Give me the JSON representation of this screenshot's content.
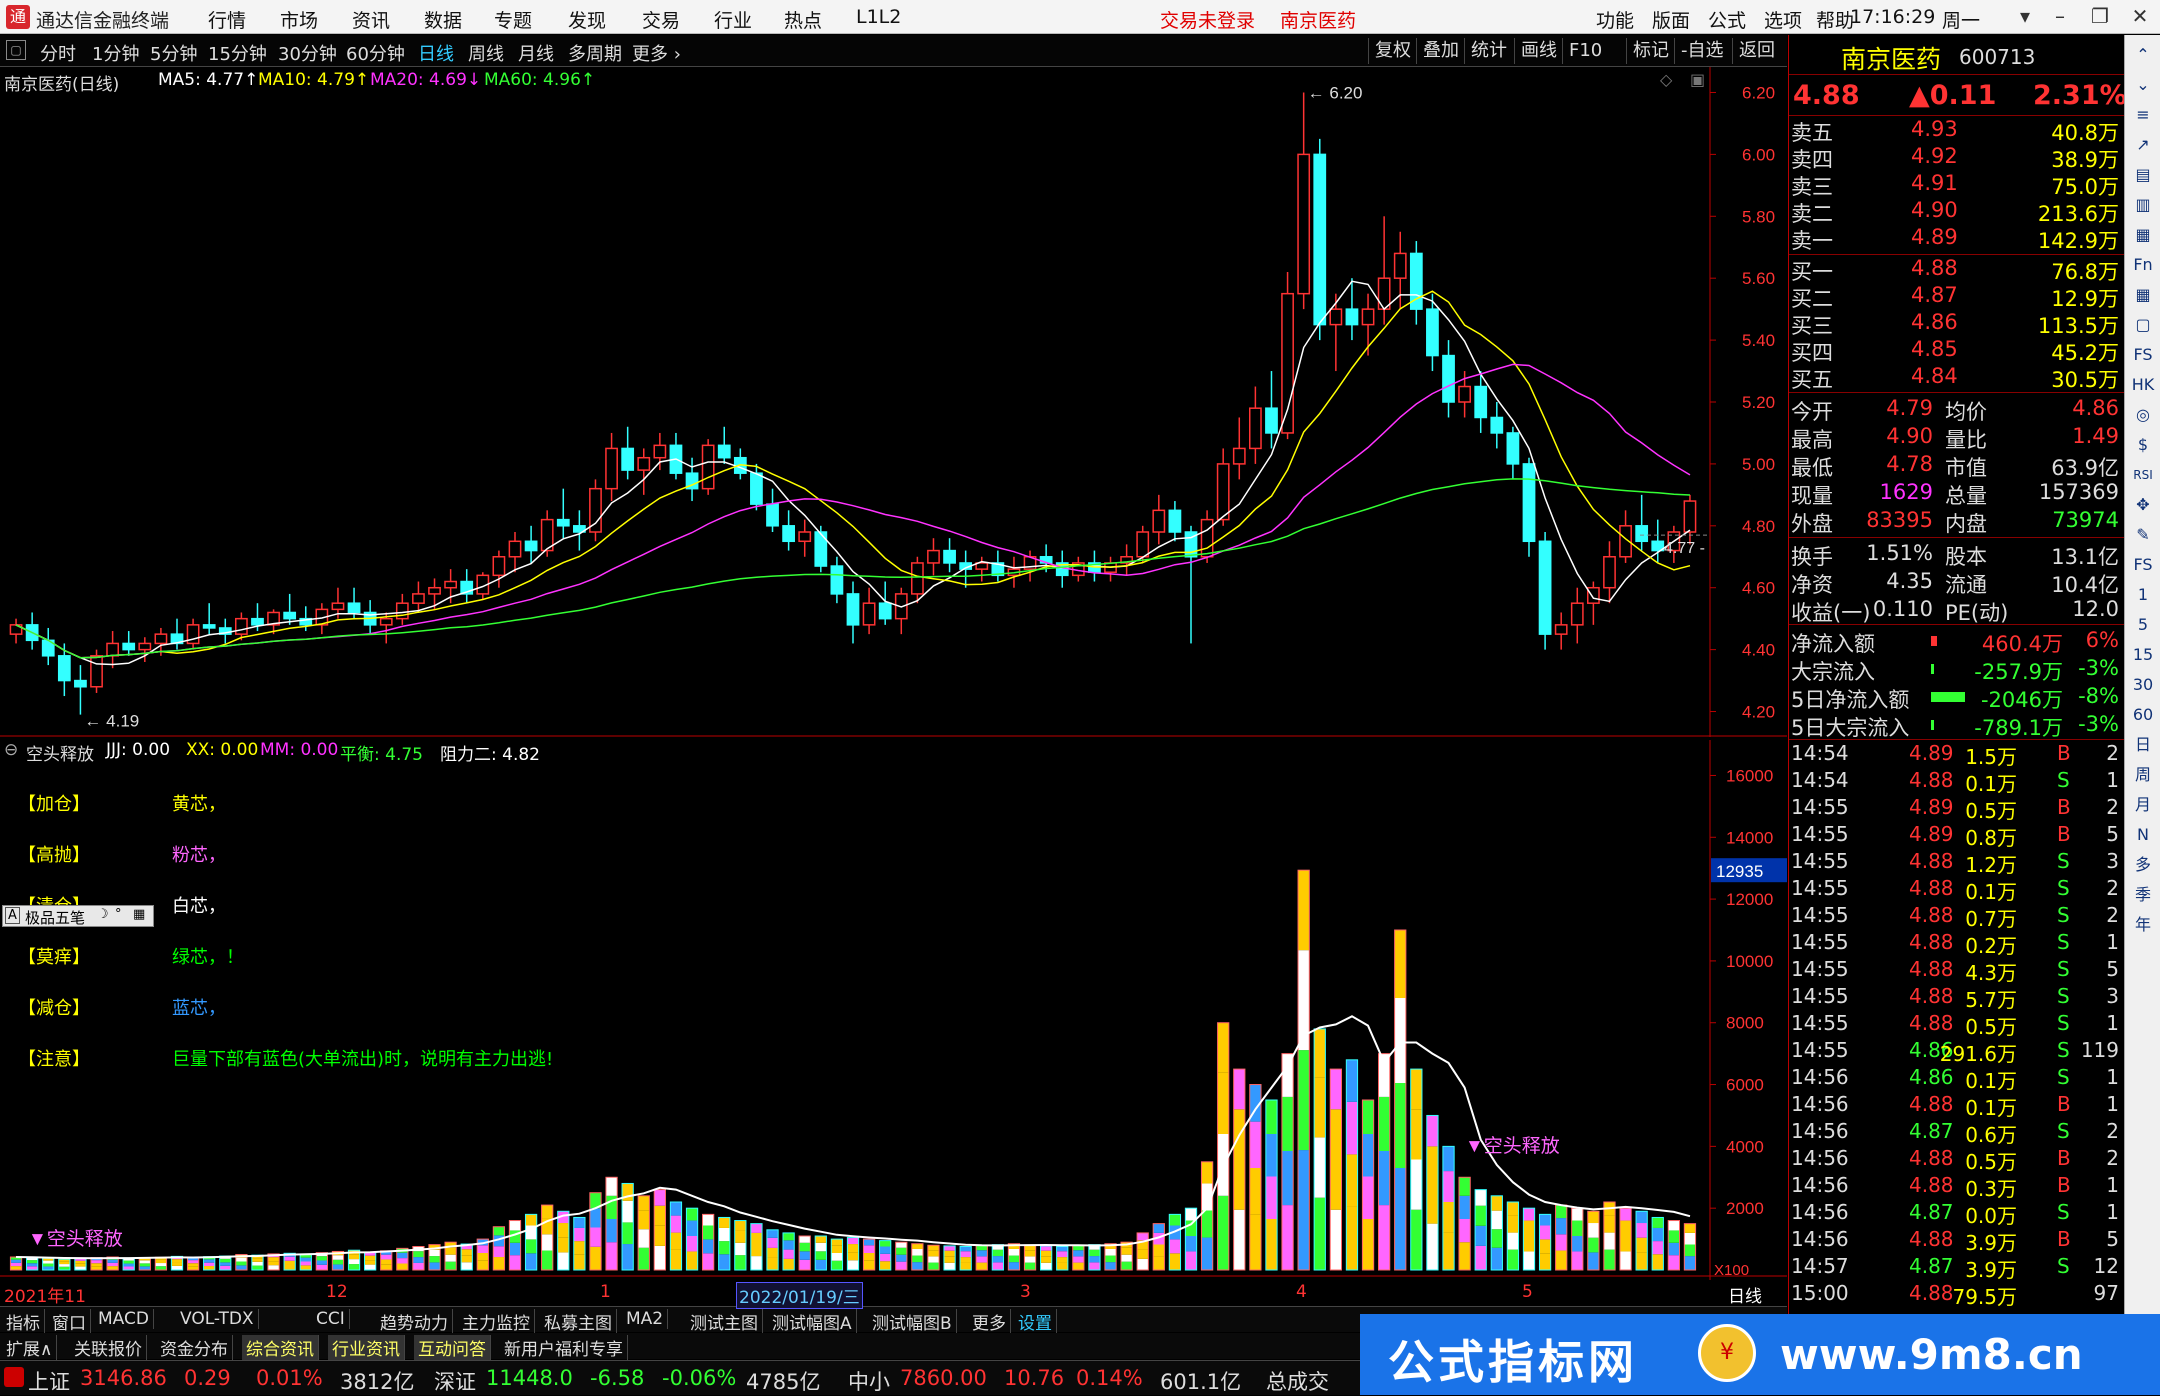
{
  "app": {
    "title": "通达信金融终端",
    "menu": [
      "行情",
      "市场",
      "资讯",
      "数据",
      "专题",
      "发现",
      "交易",
      "行业",
      "热点",
      "L1L2"
    ],
    "menu_red": [
      "交易未登录",
      "南京医药"
    ],
    "right_menu": [
      "功能",
      "版面",
      "公式",
      "选项",
      "帮助"
    ],
    "time": "17:16:29",
    "weekday": "周一"
  },
  "periods": [
    "分时",
    "1分钟",
    "5分钟",
    "15分钟",
    "30分钟",
    "60分钟",
    "日线",
    "周线",
    "月线",
    "多周期",
    "更多"
  ],
  "active_period": "日线",
  "chart_buttons": [
    "复权",
    "叠加",
    "统计",
    "画线",
    "F10",
    "标记",
    "-自选",
    "返回"
  ],
  "ma_bar": {
    "name": "南京医药(日线)",
    "ma5": "MA5: 4.77↑",
    "ma10": "MA10: 4.79↑",
    "ma20": "MA20: 4.69↓",
    "ma60": "MA60: 4.96↑"
  },
  "price_axis": [
    "6.20",
    "6.00",
    "5.80",
    "5.60",
    "5.40",
    "5.20",
    "5.00",
    "4.80",
    "4.60",
    "4.40",
    "4.20"
  ],
  "price_markers": {
    "high": "6.20",
    "low": "4.19",
    "last": "4.77"
  },
  "vol_axis": [
    "16000",
    "14000",
    "12000",
    "10000",
    "8000",
    "6000",
    "4000",
    "2000"
  ],
  "vol_current": "12935",
  "vol_unit": "X100",
  "date_axis": [
    "2021年11",
    "12",
    "1",
    "2022/01/19/三",
    "3",
    "4",
    "5"
  ],
  "indicator_bar": {
    "name": "空头释放",
    "jjj": "JJJ: 0.00",
    "xx": "XX: 0.00",
    "mm": "MM: 0.00",
    "pingheng": "平衡: 4.75",
    "zuli2": "阻力二: 4.82"
  },
  "legend": [
    {
      "tag": "【加仓】",
      "text": "黄芯，",
      "color": "#ffff00"
    },
    {
      "tag": "【高抛】",
      "text": "粉芯，",
      "color": "#ff66ff"
    },
    {
      "tag": "【清仓】",
      "text": "白芯，",
      "color": "#ffffff"
    },
    {
      "tag": "【莫痒】",
      "text": "绿芯，！",
      "color": "#00ff00"
    },
    {
      "tag": "【减仓】",
      "text": "蓝芯，",
      "color": "#3399ff"
    },
    {
      "tag": "【注意】",
      "text": "巨量下部有蓝色(大单流出)时，说明有主力出逃!",
      "color": "#00ff00"
    }
  ],
  "popup": {
    "label": "极品五笔"
  },
  "signals": [
    "▼空头释放",
    "▼空头释放"
  ],
  "quote": {
    "name": "南京医药",
    "code": "600713",
    "price": "4.88",
    "change": "▲0.11",
    "pct": "2.31%"
  },
  "order_book": {
    "sell": [
      {
        "label": "卖五",
        "price": "4.93",
        "vol": "40.8万"
      },
      {
        "label": "卖四",
        "price": "4.92",
        "vol": "38.9万"
      },
      {
        "label": "卖三",
        "price": "4.91",
        "vol": "75.0万"
      },
      {
        "label": "卖二",
        "price": "4.90",
        "vol": "213.6万"
      },
      {
        "label": "卖一",
        "price": "4.89",
        "vol": "142.9万"
      }
    ],
    "buy": [
      {
        "label": "买一",
        "price": "4.88",
        "vol": "76.8万"
      },
      {
        "label": "买二",
        "price": "4.87",
        "vol": "12.9万"
      },
      {
        "label": "买三",
        "price": "4.86",
        "vol": "113.5万"
      },
      {
        "label": "买四",
        "price": "4.85",
        "vol": "45.2万"
      },
      {
        "label": "买五",
        "price": "4.84",
        "vol": "30.5万"
      }
    ]
  },
  "stats": [
    {
      "l1": "今开",
      "v1": "4.79",
      "l2": "均价",
      "v2": "4.86"
    },
    {
      "l1": "最高",
      "v1": "4.90",
      "l2": "量比",
      "v2": "1.49"
    },
    {
      "l1": "最低",
      "v1": "4.78",
      "l2": "市值",
      "v2": "63.9亿"
    },
    {
      "l1": "现量",
      "v1": "1629",
      "l2": "总量",
      "v2": "157369"
    },
    {
      "l1": "外盘",
      "v1": "83395",
      "l2": "内盘",
      "v2": "73974"
    }
  ],
  "stats2": [
    {
      "l1": "换手",
      "v1": "1.51%",
      "l2": "股本",
      "v2": "13.1亿"
    },
    {
      "l1": "净资",
      "v1": "4.35",
      "l2": "流通",
      "v2": "10.4亿"
    },
    {
      "l1": "收益(一)",
      "v1": "0.110",
      "l2": "PE(动)",
      "v2": "12.0"
    }
  ],
  "flows": [
    {
      "label": "净流入额",
      "val": "460.4万",
      "pct": "6%"
    },
    {
      "label": "大宗流入",
      "val": "-257.9万",
      "pct": "-3%"
    },
    {
      "label": "5日净流入额",
      "val": "-2046万",
      "pct": "-8%"
    },
    {
      "label": "5日大宗流入",
      "val": "-789.1万",
      "pct": "-3%"
    }
  ],
  "ticks": [
    [
      "14:54",
      "4.89",
      "1.5万",
      "B",
      "2"
    ],
    [
      "14:54",
      "4.88",
      "0.1万",
      "S",
      "1"
    ],
    [
      "14:55",
      "4.89",
      "0.5万",
      "B",
      "2"
    ],
    [
      "14:55",
      "4.89",
      "0.8万",
      "B",
      "5"
    ],
    [
      "14:55",
      "4.88",
      "1.2万",
      "S",
      "3"
    ],
    [
      "14:55",
      "4.88",
      "0.1万",
      "S",
      "2"
    ],
    [
      "14:55",
      "4.88",
      "0.7万",
      "S",
      "2"
    ],
    [
      "14:55",
      "4.88",
      "0.2万",
      "S",
      "1"
    ],
    [
      "14:55",
      "4.88",
      "4.3万",
      "S",
      "5"
    ],
    [
      "14:55",
      "4.88",
      "5.7万",
      "S",
      "3"
    ],
    [
      "14:55",
      "4.88",
      "0.5万",
      "S",
      "1"
    ],
    [
      "14:55",
      "4.86",
      "291.6万",
      "S",
      "119"
    ],
    [
      "14:56",
      "4.86",
      "0.1万",
      "S",
      "1"
    ],
    [
      "14:56",
      "4.88",
      "0.1万",
      "B",
      "1"
    ],
    [
      "14:56",
      "4.87",
      "0.6万",
      "S",
      "2"
    ],
    [
      "14:56",
      "4.88",
      "0.5万",
      "B",
      "2"
    ],
    [
      "14:56",
      "4.88",
      "0.3万",
      "B",
      "1"
    ],
    [
      "14:56",
      "4.87",
      "0.0万",
      "S",
      "1"
    ],
    [
      "14:56",
      "4.88",
      "3.9万",
      "B",
      "5"
    ],
    [
      "14:57",
      "4.87",
      "3.9万",
      "S",
      "12"
    ],
    [
      "15:00",
      "4.88",
      "79.5万",
      "",
      "97"
    ]
  ],
  "tabs1": [
    "指标",
    "窗口",
    "MACD",
    "VOL-TDX",
    "CCI",
    "趋势动力",
    "主力监控",
    "私募主图",
    "MA2",
    "测试主图",
    "测试幅图A",
    "测试幅图B",
    "更多",
    "设置"
  ],
  "tabs2": [
    "扩展∧",
    "关联报价",
    "资金分布",
    "综合资讯",
    "行业资讯",
    "互动问答",
    "新用户福利专享"
  ],
  "status": [
    {
      "name": "上证",
      "val": "3146.86",
      "chg": "0.29",
      "pct": "0.01%",
      "amt": "3812亿"
    },
    {
      "name": "深证",
      "val": "11448.0",
      "chg": "-6.58",
      "pct": "-0.06%",
      "amt": "4785亿"
    },
    {
      "name": "中小",
      "val": "7860.00",
      "chg": "10.76",
      "pct": "0.14%",
      "amt": "601.1亿"
    }
  ],
  "status_tail": "总成交",
  "banner": {
    "text": "公式指标网",
    "url": "www.9m8.cn"
  },
  "sidebar_icons": [
    "up-icon",
    "down-icon",
    "list-icon",
    "chart-icon",
    "stats-icon",
    "bar-icon",
    "box-icon",
    "fn-icon",
    "grid-icon",
    "book-icon",
    "fs-icon",
    "hk-icon",
    "cycle-icon",
    "fin-icon",
    "rsi-icon",
    "move-icon",
    "pen-icon",
    "fs2-icon",
    "num1",
    "num5",
    "num15",
    "num30",
    "num60",
    "ri",
    "zhou",
    "yue",
    "n",
    "duo",
    "ji",
    "nian"
  ],
  "sidebar_labels": [
    "日",
    "周",
    "月",
    "N",
    "多",
    "季",
    "年"
  ],
  "chart_data": {
    "type": "candlestick",
    "ylim": [
      4.15,
      6.25
    ],
    "candles": [
      [
        4.45,
        4.5,
        4.42,
        4.48
      ],
      [
        4.48,
        4.52,
        4.4,
        4.43
      ],
      [
        4.43,
        4.47,
        4.35,
        4.38
      ],
      [
        4.38,
        4.42,
        4.25,
        4.3
      ],
      [
        4.3,
        4.35,
        4.19,
        4.28
      ],
      [
        4.28,
        4.4,
        4.26,
        4.38
      ],
      [
        4.38,
        4.46,
        4.34,
        4.42
      ],
      [
        4.42,
        4.46,
        4.38,
        4.4
      ],
      [
        4.4,
        4.44,
        4.36,
        4.42
      ],
      [
        4.42,
        4.47,
        4.38,
        4.45
      ],
      [
        4.45,
        4.5,
        4.4,
        4.42
      ],
      [
        4.42,
        4.5,
        4.4,
        4.48
      ],
      [
        4.48,
        4.55,
        4.45,
        4.47
      ],
      [
        4.47,
        4.5,
        4.42,
        4.45
      ],
      [
        4.45,
        4.52,
        4.43,
        4.5
      ],
      [
        4.5,
        4.55,
        4.46,
        4.48
      ],
      [
        4.48,
        4.53,
        4.45,
        4.52
      ],
      [
        4.52,
        4.58,
        4.48,
        4.5
      ],
      [
        4.5,
        4.54,
        4.46,
        4.48
      ],
      [
        4.48,
        4.55,
        4.45,
        4.53
      ],
      [
        4.53,
        4.6,
        4.5,
        4.55
      ],
      [
        4.55,
        4.6,
        4.5,
        4.52
      ],
      [
        4.52,
        4.56,
        4.45,
        4.48
      ],
      [
        4.48,
        4.52,
        4.42,
        4.5
      ],
      [
        4.5,
        4.58,
        4.48,
        4.55
      ],
      [
        4.55,
        4.62,
        4.52,
        4.58
      ],
      [
        4.58,
        4.63,
        4.53,
        4.6
      ],
      [
        4.6,
        4.66,
        4.55,
        4.62
      ],
      [
        4.62,
        4.66,
        4.55,
        4.58
      ],
      [
        4.58,
        4.65,
        4.56,
        4.64
      ],
      [
        4.64,
        4.72,
        4.6,
        4.7
      ],
      [
        4.7,
        4.78,
        4.65,
        4.75
      ],
      [
        4.75,
        4.8,
        4.68,
        4.72
      ],
      [
        4.72,
        4.85,
        4.7,
        4.82
      ],
      [
        4.82,
        4.92,
        4.76,
        4.8
      ],
      [
        4.8,
        4.85,
        4.72,
        4.78
      ],
      [
        4.78,
        4.95,
        4.75,
        4.92
      ],
      [
        4.92,
        5.1,
        4.88,
        5.05
      ],
      [
        5.05,
        5.12,
        4.95,
        4.98
      ],
      [
        4.98,
        5.05,
        4.9,
        5.02
      ],
      [
        5.02,
        5.1,
        4.98,
        5.06
      ],
      [
        5.06,
        5.1,
        4.95,
        4.97
      ],
      [
        4.97,
        5.02,
        4.88,
        4.92
      ],
      [
        4.92,
        5.08,
        4.9,
        5.06
      ],
      [
        5.06,
        5.12,
        5.0,
        5.02
      ],
      [
        5.02,
        5.05,
        4.95,
        4.97
      ],
      [
        4.97,
        5.0,
        4.85,
        4.87
      ],
      [
        4.87,
        4.92,
        4.78,
        4.8
      ],
      [
        4.8,
        4.85,
        4.72,
        4.75
      ],
      [
        4.75,
        4.82,
        4.7,
        4.78
      ],
      [
        4.78,
        4.8,
        4.65,
        4.67
      ],
      [
        4.67,
        4.7,
        4.55,
        4.58
      ],
      [
        4.58,
        4.62,
        4.42,
        4.48
      ],
      [
        4.48,
        4.6,
        4.45,
        4.55
      ],
      [
        4.55,
        4.62,
        4.48,
        4.5
      ],
      [
        4.5,
        4.6,
        4.45,
        4.58
      ],
      [
        4.58,
        4.7,
        4.55,
        4.68
      ],
      [
        4.68,
        4.76,
        4.64,
        4.72
      ],
      [
        4.72,
        4.76,
        4.65,
        4.68
      ],
      [
        4.68,
        4.72,
        4.6,
        4.66
      ],
      [
        4.66,
        4.7,
        4.62,
        4.68
      ],
      [
        4.68,
        4.72,
        4.62,
        4.64
      ],
      [
        4.64,
        4.7,
        4.6,
        4.66
      ],
      [
        4.66,
        4.72,
        4.62,
        4.7
      ],
      [
        4.7,
        4.74,
        4.65,
        4.68
      ],
      [
        4.68,
        4.72,
        4.6,
        4.64
      ],
      [
        4.64,
        4.7,
        4.62,
        4.68
      ],
      [
        4.68,
        4.72,
        4.62,
        4.65
      ],
      [
        4.65,
        4.7,
        4.62,
        4.68
      ],
      [
        4.68,
        4.74,
        4.64,
        4.7
      ],
      [
        4.7,
        4.8,
        4.68,
        4.78
      ],
      [
        4.78,
        4.9,
        4.74,
        4.85
      ],
      [
        4.85,
        4.88,
        4.75,
        4.78
      ],
      [
        4.78,
        4.8,
        4.42,
        4.7
      ],
      [
        4.7,
        4.85,
        4.68,
        4.82
      ],
      [
        4.82,
        5.05,
        4.8,
        5.0
      ],
      [
        5.0,
        5.15,
        4.95,
        5.05
      ],
      [
        5.05,
        5.25,
        5.0,
        5.18
      ],
      [
        5.18,
        5.3,
        5.05,
        5.1
      ],
      [
        5.1,
        5.62,
        5.08,
        5.55
      ],
      [
        5.55,
        6.2,
        5.5,
        6.0
      ],
      [
        6.0,
        6.05,
        5.4,
        5.45
      ],
      [
        5.45,
        5.55,
        5.3,
        5.5
      ],
      [
        5.5,
        5.6,
        5.4,
        5.45
      ],
      [
        5.45,
        5.55,
        5.35,
        5.5
      ],
      [
        5.5,
        5.8,
        5.45,
        5.6
      ],
      [
        5.6,
        5.75,
        5.5,
        5.68
      ],
      [
        5.68,
        5.72,
        5.45,
        5.5
      ],
      [
        5.5,
        5.55,
        5.3,
        5.35
      ],
      [
        5.35,
        5.4,
        5.15,
        5.2
      ],
      [
        5.2,
        5.3,
        5.15,
        5.25
      ],
      [
        5.25,
        5.3,
        5.1,
        5.15
      ],
      [
        5.15,
        5.2,
        5.05,
        5.1
      ],
      [
        5.1,
        5.12,
        4.95,
        5.0
      ],
      [
        5.0,
        5.02,
        4.7,
        4.75
      ],
      [
        4.75,
        4.78,
        4.4,
        4.45
      ],
      [
        4.45,
        4.52,
        4.4,
        4.48
      ],
      [
        4.48,
        4.6,
        4.42,
        4.55
      ],
      [
        4.55,
        4.62,
        4.48,
        4.6
      ],
      [
        4.6,
        4.75,
        4.55,
        4.7
      ],
      [
        4.7,
        4.85,
        4.68,
        4.8
      ],
      [
        4.8,
        4.9,
        4.72,
        4.75
      ],
      [
        4.75,
        4.82,
        4.68,
        4.72
      ],
      [
        4.72,
        4.8,
        4.68,
        4.78
      ],
      [
        4.78,
        4.9,
        4.74,
        4.88
      ]
    ],
    "volumes": [
      420,
      400,
      380,
      350,
      370,
      400,
      420,
      380,
      390,
      410,
      440,
      400,
      430,
      450,
      500,
      480,
      520,
      540,
      500,
      560,
      600,
      640,
      580,
      620,
      700,
      760,
      820,
      900,
      840,
      1000,
      1400,
      1600,
      1800,
      2100,
      1900,
      1700,
      2500,
      3000,
      2800,
      2400,
      2600,
      2200,
      2000,
      1800,
      1700,
      1600,
      1500,
      1300,
      1200,
      1100,
      1100,
      1000,
      1050,
      1000,
      950,
      900,
      850,
      800,
      780,
      760,
      800,
      820,
      850,
      800,
      780,
      760,
      800,
      820,
      850,
      900,
      1200,
      1500,
      1800,
      2000,
      3500,
      8000,
      6500,
      6000,
      5500,
      7000,
      12935,
      7800,
      6500,
      6800,
      5500,
      7000,
      11000,
      6500,
      5000,
      4000,
      3000,
      2600,
      2400,
      2200,
      2000,
      1800,
      2100,
      2000,
      1900,
      2200,
      2000,
      1900,
      1700,
      1600,
      1500
    ]
  }
}
